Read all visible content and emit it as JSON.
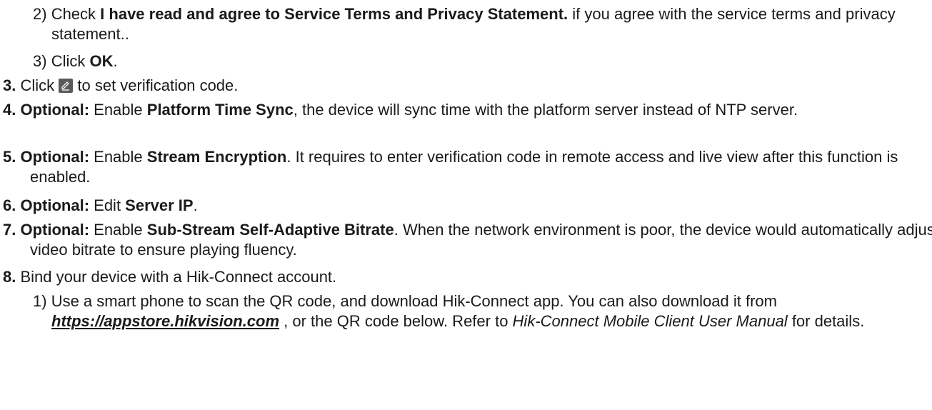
{
  "sub2": {
    "num": "2)",
    "pre": "Check ",
    "bold": "I have read and agree to Service Terms and Privacy Statement.",
    "post": " if you agree with the service terms and privacy statement.."
  },
  "sub3": {
    "num": "3)",
    "pre": "Click ",
    "bold": "OK",
    "post": "."
  },
  "step3": {
    "num": "3.",
    "pre": "Click ",
    "icon": "edit-pencil-icon",
    "post": " to set verification code."
  },
  "step4": {
    "num": "4.",
    "optional": "Optional:",
    "pre": " Enable ",
    "bold": "Platform Time Sync",
    "post": ", the device will sync time with the platform server instead of NTP server."
  },
  "step5": {
    "num": "5.",
    "optional": "Optional:",
    "pre": " Enable ",
    "bold": "Stream Encryption",
    "post": ". It requires to enter verification code in remote access and live view after this function is enabled."
  },
  "step6": {
    "num": "6.",
    "optional": "Optional:",
    "pre": " Edit ",
    "bold": "Server IP",
    "post": "."
  },
  "step7": {
    "num": "7.",
    "optional": "Optional:",
    "pre": " Enable ",
    "bold": "Sub-Stream Self-Adaptive Bitrate",
    "post": ". When the network environment is poor, the device would automatically adjust video bitrate to ensure playing fluency."
  },
  "step8": {
    "num": "8.",
    "text": "Bind your device with a Hik-Connect account."
  },
  "sub8_1": {
    "num": "1)",
    "pre": "Use a smart phone to scan the QR code, and download Hik-Connect app. You can also download it from ",
    "link": "https://appstore.hikvision.com",
    "mid": " , or the QR code below. Refer to ",
    "italic": "Hik-Connect Mobile Client User Manual",
    "post": " for details."
  }
}
